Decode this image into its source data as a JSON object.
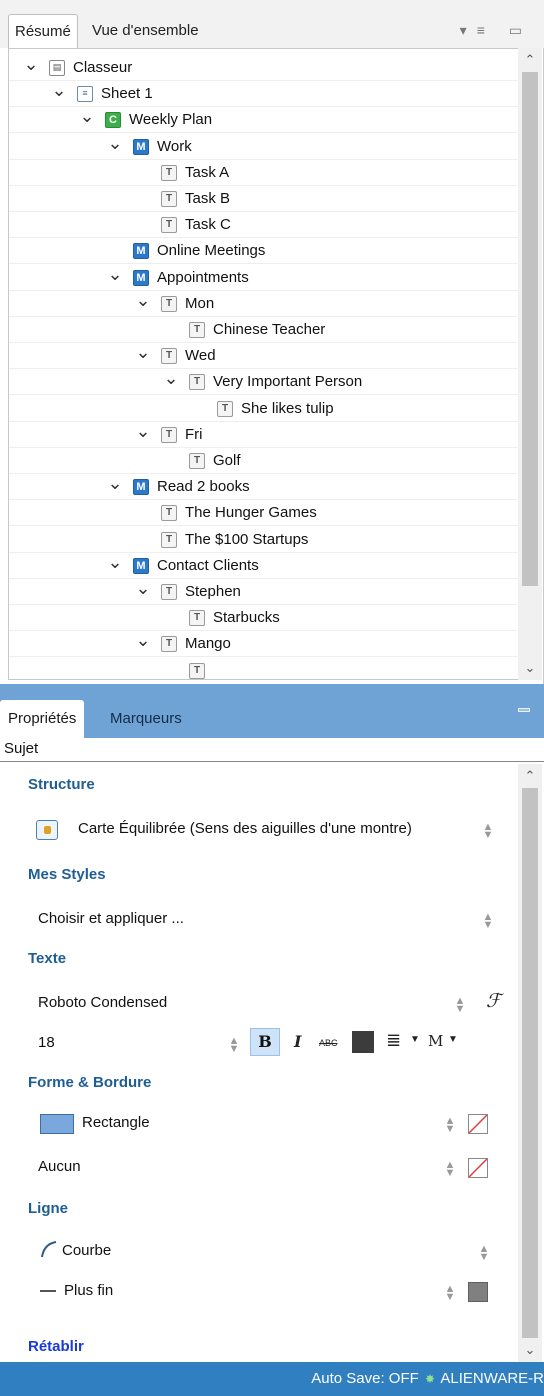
{
  "outline_panel": {
    "tabs": [
      "Résumé",
      "Vue d'ensemble"
    ],
    "rows": [
      {
        "label": "Classeur",
        "icon": "workbook-icon",
        "level": 0,
        "expanded": true
      },
      {
        "label": "Sheet 1",
        "icon": "sheet-icon",
        "level": 1,
        "expanded": true
      },
      {
        "label": "Weekly Plan",
        "icon": "central-topic-icon",
        "level": 2,
        "expanded": true
      },
      {
        "label": "Work",
        "icon": "main-topic-icon",
        "level": 3,
        "expanded": true
      },
      {
        "label": "Task A",
        "icon": "subtopic-icon",
        "level": 4,
        "expanded": null
      },
      {
        "label": "Task B",
        "icon": "subtopic-icon",
        "level": 4,
        "expanded": null
      },
      {
        "label": "Task C",
        "icon": "subtopic-icon",
        "level": 4,
        "expanded": null
      },
      {
        "label": "Online Meetings",
        "icon": "main-topic-icon",
        "level": 3,
        "expanded": null
      },
      {
        "label": "Appointments",
        "icon": "main-topic-icon",
        "level": 3,
        "expanded": true
      },
      {
        "label": "Mon",
        "icon": "subtopic-icon",
        "level": 4,
        "expanded": true
      },
      {
        "label": "Chinese Teacher",
        "icon": "subtopic-icon",
        "level": 5,
        "expanded": null
      },
      {
        "label": "Wed",
        "icon": "subtopic-icon",
        "level": 4,
        "expanded": true
      },
      {
        "label": "Very Important Person",
        "icon": "subtopic-icon",
        "level": 5,
        "expanded": true
      },
      {
        "label": "She likes tulip",
        "icon": "subtopic-icon",
        "level": 6,
        "expanded": null
      },
      {
        "label": "Fri",
        "icon": "subtopic-icon",
        "level": 4,
        "expanded": true
      },
      {
        "label": "Golf",
        "icon": "subtopic-icon",
        "level": 5,
        "expanded": null
      },
      {
        "label": "Read 2 books",
        "icon": "main-topic-icon",
        "level": 3,
        "expanded": true
      },
      {
        "label": "The Hunger Games",
        "icon": "subtopic-icon",
        "level": 4,
        "expanded": null
      },
      {
        "label": "The $100 Startups",
        "icon": "subtopic-icon",
        "level": 4,
        "expanded": null
      },
      {
        "label": "Contact Clients",
        "icon": "main-topic-icon",
        "level": 3,
        "expanded": true
      },
      {
        "label": "Stephen",
        "icon": "subtopic-icon",
        "level": 4,
        "expanded": true
      },
      {
        "label": "Starbucks",
        "icon": "subtopic-icon",
        "level": 5,
        "expanded": null
      },
      {
        "label": "Mango",
        "icon": "subtopic-icon",
        "level": 4,
        "expanded": true
      },
      {
        "label": "",
        "icon": "subtopic-icon",
        "level": 5,
        "expanded": null
      }
    ]
  },
  "properties_panel": {
    "tabs": [
      "Propriétés",
      "Marqueurs"
    ],
    "subject": "Sujet",
    "structure": {
      "title": "Structure",
      "value": "Carte Équilibrée (Sens des aiguilles d'une montre)"
    },
    "styles": {
      "title": "Mes Styles",
      "value": "Choisir et appliquer ..."
    },
    "text": {
      "title": "Texte",
      "font": "Roboto Condensed",
      "size": "18",
      "strike_label": "ABC",
      "more_label": "M"
    },
    "shape": {
      "title": "Forme & Bordure",
      "shape_value": "Rectangle",
      "border_value": "Aucun",
      "fill_color": "#7aa8dc"
    },
    "line": {
      "title": "Ligne",
      "style_value": "Courbe",
      "width_value": "Plus fin",
      "line_color": "#808080"
    },
    "reset_label": "Rétablir"
  },
  "status_bar": {
    "text": "Auto Save: OFF",
    "machine": "ALIENWARE-R"
  },
  "colors": {
    "accent": "#2f7fc1",
    "section_title": "#1f5e94",
    "link": "#1a3ad8"
  }
}
